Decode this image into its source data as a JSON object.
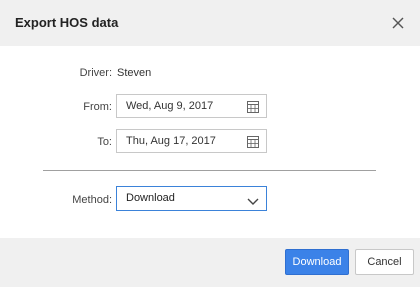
{
  "dialog": {
    "title": "Export HOS data",
    "close_icon": "close-icon"
  },
  "form": {
    "driver_label": "Driver:",
    "driver_value": "Steven",
    "from_label": "From:",
    "from_value": "Wed, Aug 9, 2017",
    "to_label": "To:",
    "to_value": "Thu, Aug 17, 2017",
    "calendar_icon": "calendar-icon",
    "method_label": "Method:",
    "method_value": "Download",
    "chevron_icon": "chevron-down-icon"
  },
  "footer": {
    "primary_label": "Download",
    "cancel_label": "Cancel"
  },
  "colors": {
    "header_bg": "#f0f0f0",
    "primary": "#3b82e8",
    "focus_border": "#3b82d9"
  }
}
